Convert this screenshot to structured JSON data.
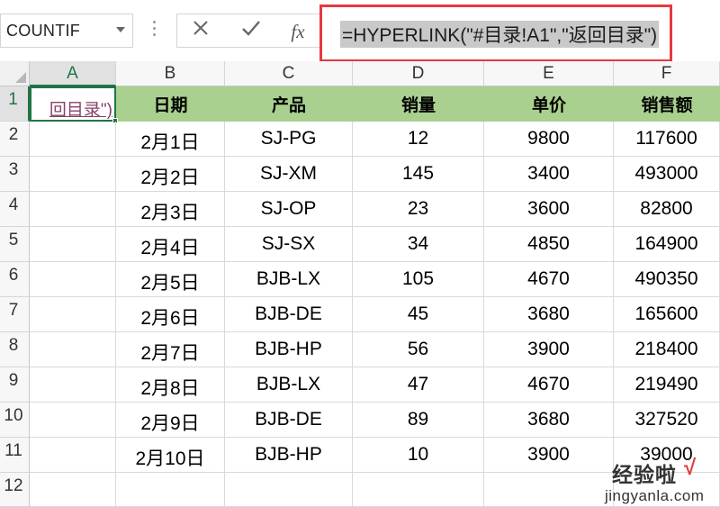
{
  "name_box": {
    "value": "COUNTIF"
  },
  "formula_bar": {
    "cancel_icon": "close-icon",
    "enter_icon": "checkmark-icon",
    "function_label": "fx",
    "formula": "=HYPERLINK(\"#目录!A1\",\"返回目录\")"
  },
  "columns": [
    "A",
    "B",
    "C",
    "D",
    "E",
    "F"
  ],
  "selected_column": "A",
  "rows": [
    "1",
    "2",
    "3",
    "4",
    "5",
    "6",
    "7",
    "8",
    "9",
    "10",
    "11",
    "12"
  ],
  "selected_row": "1",
  "active_cell": {
    "ref": "A1",
    "display": "回目录\")"
  },
  "headers": {
    "date": "日期",
    "product": "产品",
    "qty": "销量",
    "price": "单价",
    "sales": "销售额"
  },
  "table": [
    [
      "2月1日",
      "SJ-PG",
      "12",
      "9800",
      "117600"
    ],
    [
      "2月2日",
      "SJ-XM",
      "145",
      "3400",
      "493000"
    ],
    [
      "2月3日",
      "SJ-OP",
      "23",
      "3600",
      "82800"
    ],
    [
      "2月4日",
      "SJ-SX",
      "34",
      "4850",
      "164900"
    ],
    [
      "2月5日",
      "BJB-LX",
      "105",
      "4670",
      "490350"
    ],
    [
      "2月6日",
      "BJB-DE",
      "45",
      "3680",
      "165600"
    ],
    [
      "2月7日",
      "BJB-HP",
      "56",
      "3900",
      "218400"
    ],
    [
      "2月8日",
      "BJB-LX",
      "47",
      "4670",
      "219490"
    ],
    [
      "2月9日",
      "BJB-DE",
      "89",
      "3680",
      "327520"
    ],
    [
      "2月10日",
      "BJB-HP",
      "10",
      "3900",
      "39000"
    ]
  ],
  "colors": {
    "header_fill": "#a9d08e",
    "highlight_border": "#e5393f",
    "selection": "#217346",
    "hyperlink": "#8a3f69"
  },
  "watermark": {
    "top": "经验啦",
    "check": "√",
    "bottom": "jingyanla.com"
  }
}
